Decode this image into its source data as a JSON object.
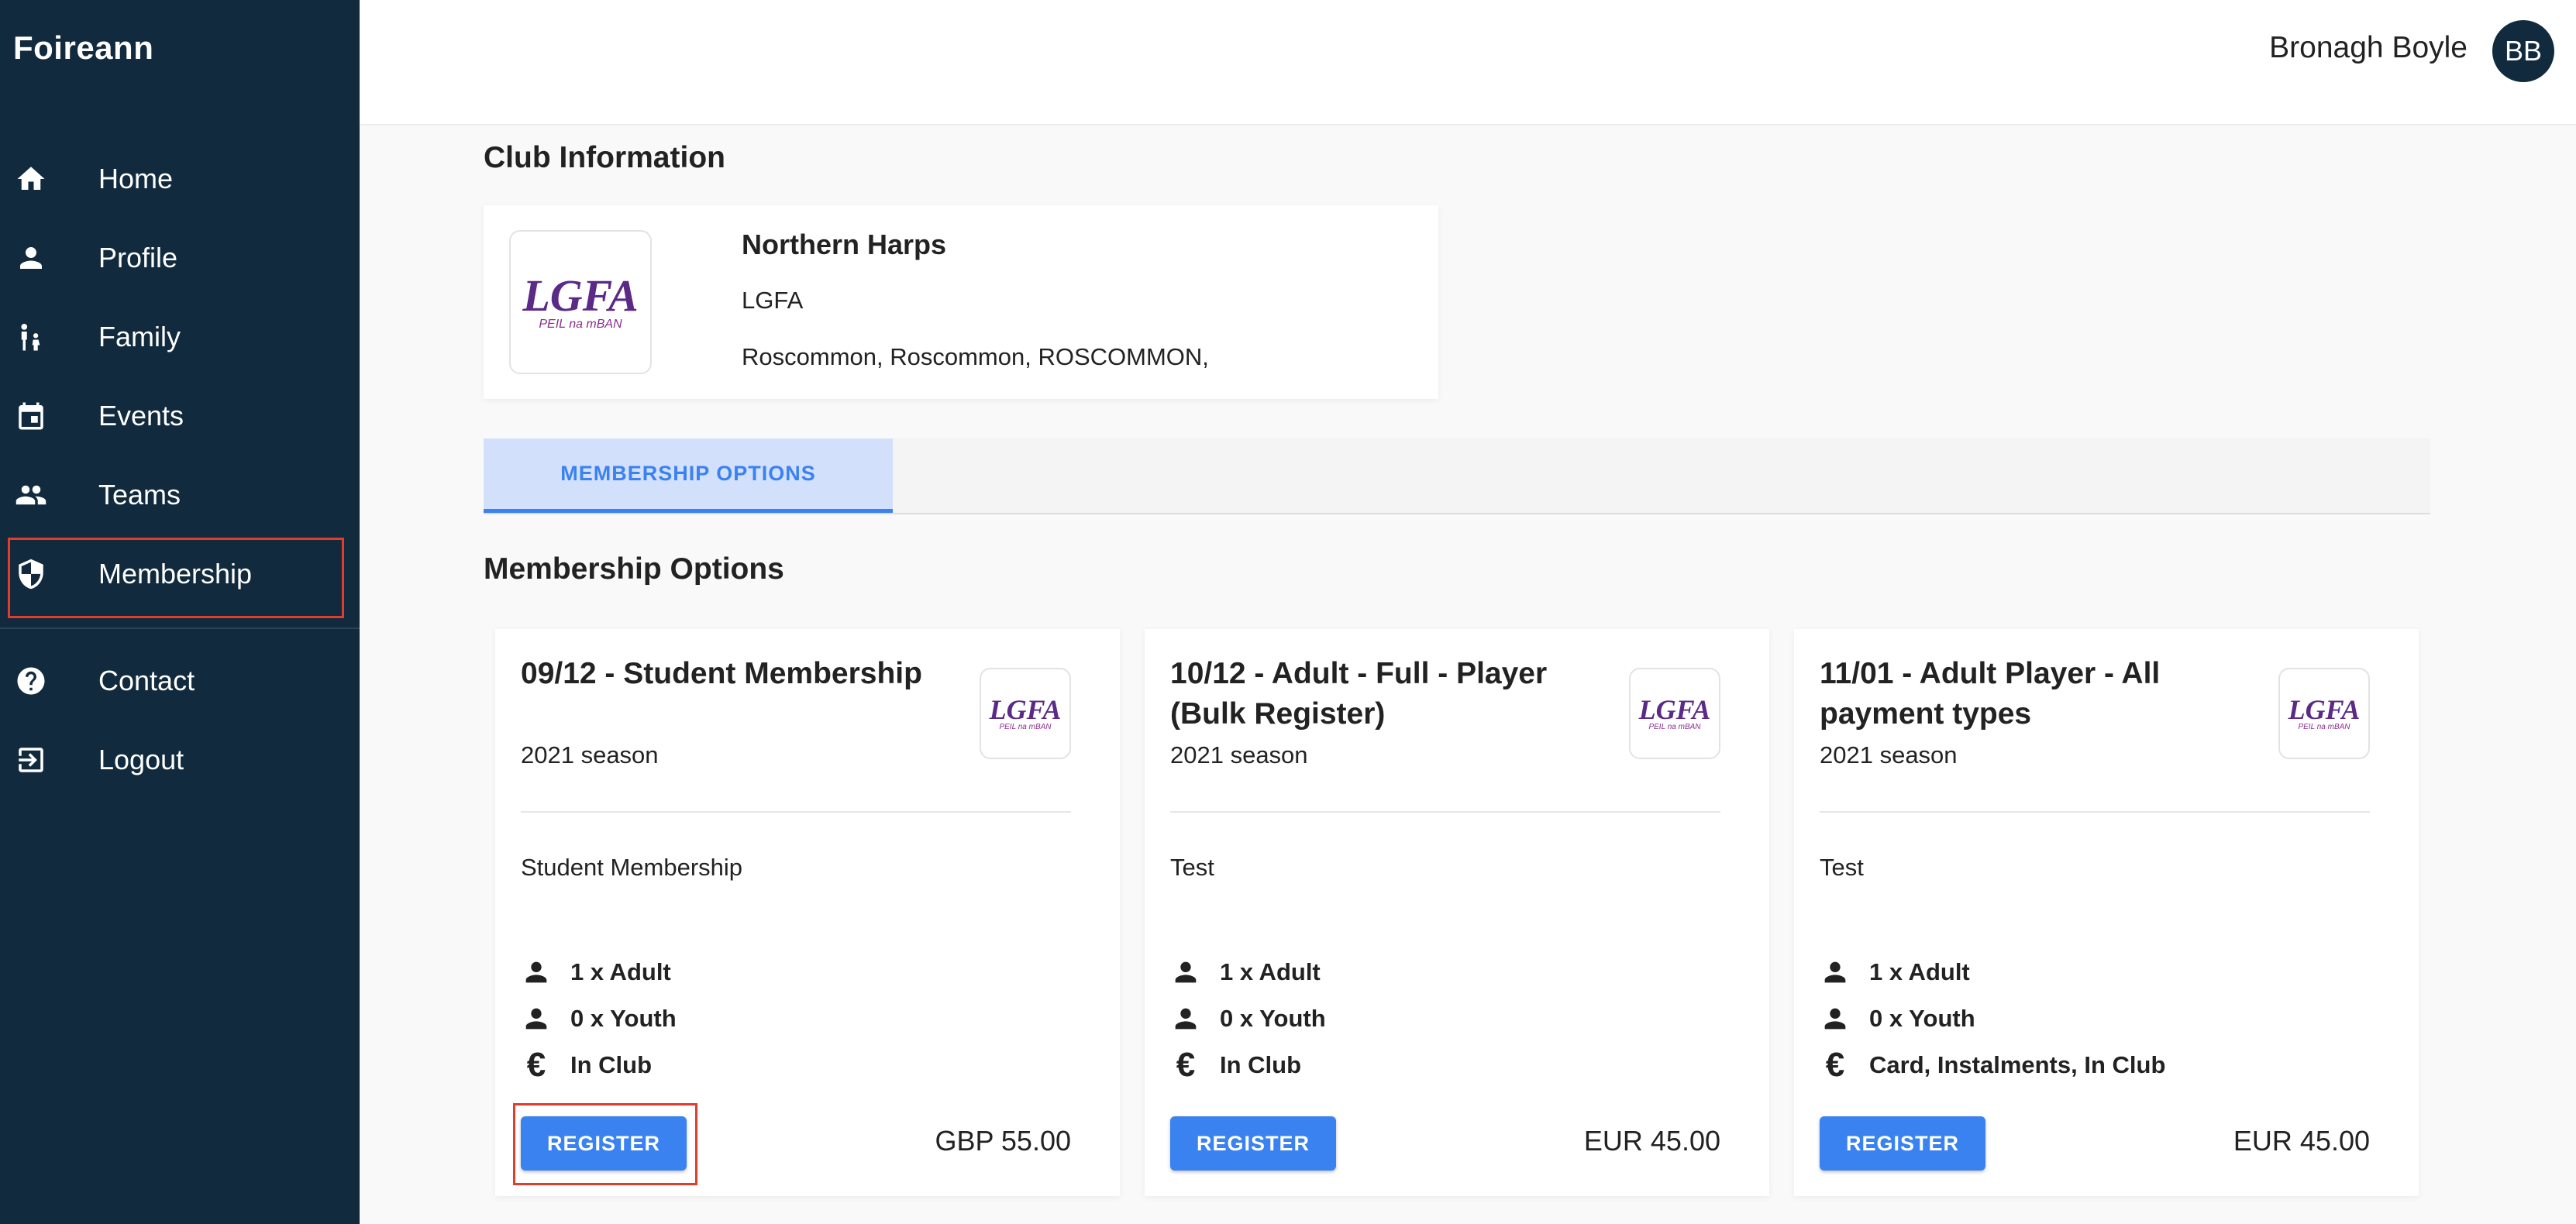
{
  "app": {
    "brand": "Foireann"
  },
  "sidebar": {
    "items": [
      {
        "label": "Home",
        "icon": "home-icon"
      },
      {
        "label": "Profile",
        "icon": "person-icon"
      },
      {
        "label": "Family",
        "icon": "family-icon"
      },
      {
        "label": "Events",
        "icon": "calendar-icon"
      },
      {
        "label": "Teams",
        "icon": "group-icon"
      },
      {
        "label": "Membership",
        "icon": "shield-icon",
        "active": true
      },
      {
        "label": "Contact",
        "icon": "help-icon"
      },
      {
        "label": "Logout",
        "icon": "logout-icon"
      }
    ]
  },
  "header": {
    "user_name": "Bronagh Boyle",
    "avatar_initials": "BB"
  },
  "club": {
    "section_title": "Club Information",
    "logo_text": "LGFA",
    "logo_subtext": "PEIL na mBAN",
    "name": "Northern Harps",
    "org": "LGFA",
    "address": "Roscommon, Roscommon, ROSCOMMON,"
  },
  "tabs": [
    {
      "label": "MEMBERSHIP OPTIONS",
      "active": true
    }
  ],
  "membership": {
    "section_title": "Membership Options",
    "cards": [
      {
        "title": "09/12 - Student Membership",
        "season": "2021 season",
        "description": "Student Membership",
        "adult": "1 x Adult",
        "youth": "0 x Youth",
        "payment": "In Club",
        "button": "REGISTER",
        "price": "GBP 55.00"
      },
      {
        "title": "10/12 - Adult - Full - Player (Bulk Register)",
        "season": "2021 season",
        "description": "Test",
        "adult": "1 x Adult",
        "youth": "0 x Youth",
        "payment": "In Club",
        "button": "REGISTER",
        "price": "EUR 45.00"
      },
      {
        "title": "11/01 - Adult Player - All payment types",
        "season": "2021 season",
        "description": "Test",
        "adult": "1 x Adult",
        "youth": "0 x Youth",
        "payment": "Card, Instalments, In Club",
        "button": "REGISTER",
        "price": "EUR 45.00"
      }
    ]
  },
  "colors": {
    "sidebar_bg": "#112a3d",
    "accent": "#3a82f0",
    "highlight": "#e23c2a"
  }
}
